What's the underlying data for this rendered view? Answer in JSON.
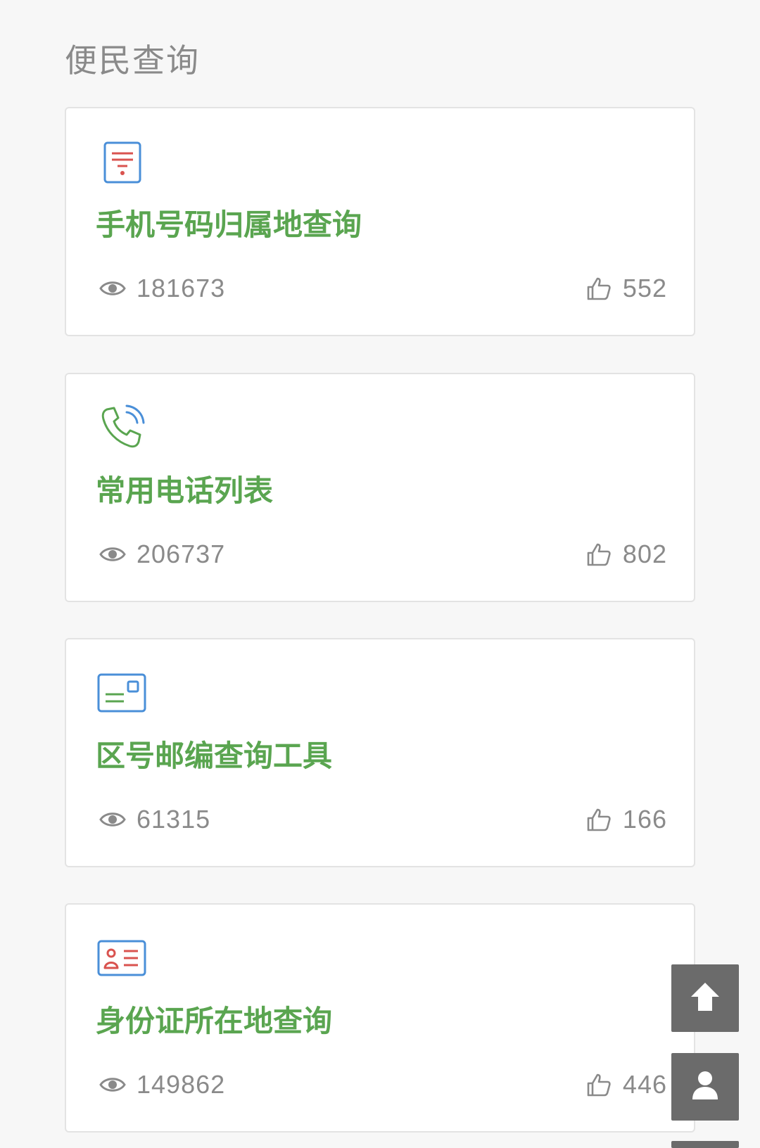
{
  "section": {
    "title": "便民查询"
  },
  "cards": [
    {
      "icon": "document-icon",
      "title": "手机号码归属地查询",
      "views": "181673",
      "likes": "552"
    },
    {
      "icon": "phone-icon",
      "title": "常用电话列表",
      "views": "206737",
      "likes": "802"
    },
    {
      "icon": "card-icon",
      "title": "区号邮编查询工具",
      "views": "61315",
      "likes": "166"
    },
    {
      "icon": "id-card-icon",
      "title": "身份证所在地查询",
      "views": "149862",
      "likes": "446"
    }
  ],
  "floating": {
    "top_icon": "arrow-up-icon",
    "user_icon": "user-icon"
  },
  "colors": {
    "title_green": "#5aa550",
    "text_gray": "#8a8a8a",
    "fab_gray": "#6b6b6b",
    "icon_blue": "#4a8fd8",
    "icon_red": "#d9534f"
  }
}
